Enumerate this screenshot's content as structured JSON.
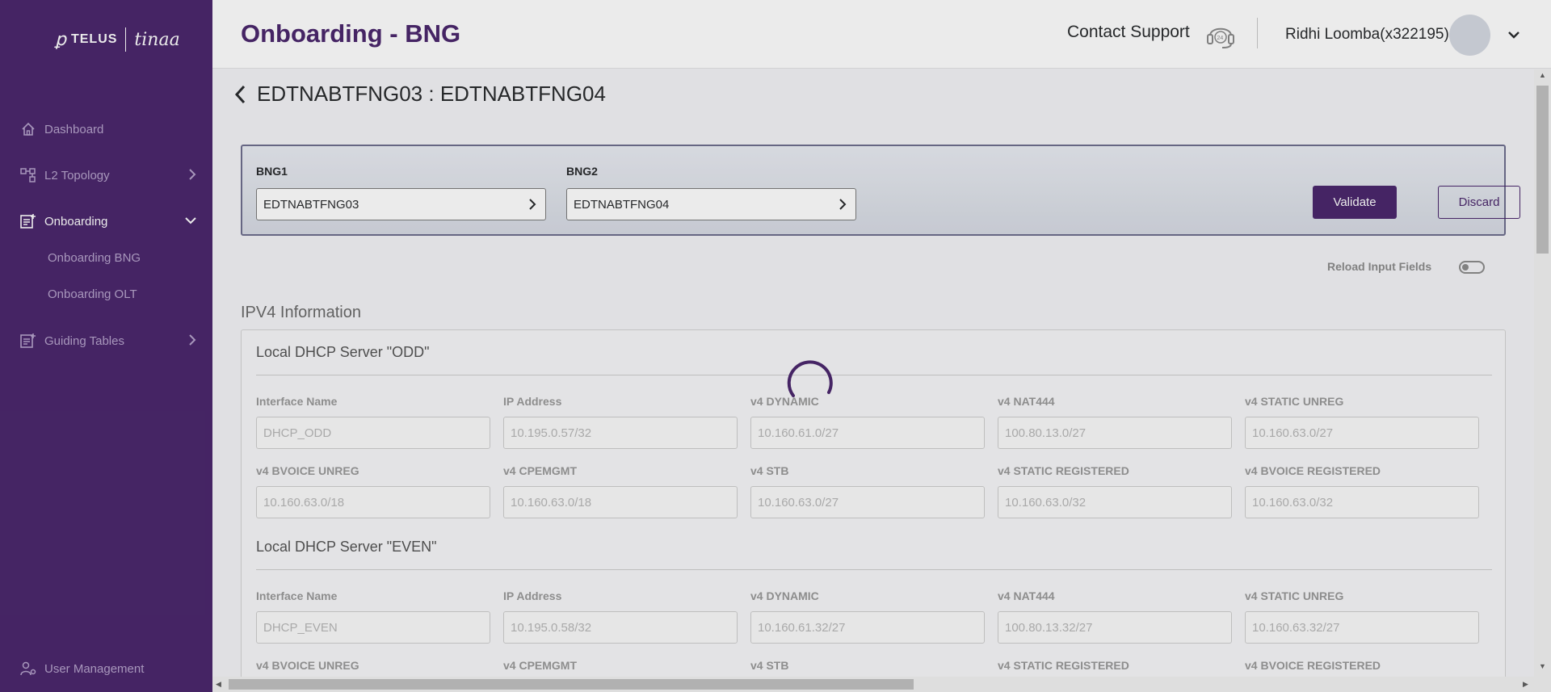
{
  "brand": {
    "mark": "ꝑ",
    "name": "TELUS",
    "product": "tinaa"
  },
  "sidebar": {
    "items": [
      {
        "label": "Dashboard",
        "icon": "home-icon"
      },
      {
        "label": "L2 Topology",
        "icon": "topology-icon"
      },
      {
        "label": "Onboarding",
        "icon": "onboarding-icon",
        "expanded": true
      },
      {
        "label": "Guiding Tables",
        "icon": "table-icon"
      }
    ],
    "sub_items": [
      {
        "label": "Onboarding BNG"
      },
      {
        "label": "Onboarding OLT"
      }
    ],
    "footer": {
      "label": "User Management",
      "icon": "user-gear-icon"
    }
  },
  "header": {
    "title": "Onboarding - BNG",
    "support_label": "Contact Support",
    "support_icon": "headset-24-icon",
    "user_name": "Ridhi Loomba(x322195)"
  },
  "page": {
    "breadcrumb_title": "EDTNABTFNG03 : EDTNABTFNG04",
    "bng1_label": "BNG1",
    "bng1_value": "EDTNABTFNG03",
    "bng2_label": "BNG2",
    "bng2_value": "EDTNABTFNG04",
    "validate_label": "Validate",
    "discard_label": "Discard",
    "reload_label": "Reload Input Fields",
    "reload_enabled": false,
    "section_title": "IPV4 Information",
    "loading": true
  },
  "servers": [
    {
      "title": "Local DHCP Server \"ODD\"",
      "fields": [
        {
          "label": "Interface Name",
          "value": "DHCP_ODD"
        },
        {
          "label": "IP Address",
          "value": "10.195.0.57/32"
        },
        {
          "label": "v4 DYNAMIC",
          "value": "10.160.61.0/27"
        },
        {
          "label": "v4 NAT444",
          "value": "100.80.13.0/27"
        },
        {
          "label": "v4 STATIC UNREG",
          "value": "10.160.63.0/27"
        },
        {
          "label": "v4 BVOICE UNREG",
          "value": "10.160.63.0/18"
        },
        {
          "label": "v4 CPEMGMT",
          "value": "10.160.63.0/18"
        },
        {
          "label": "v4 STB",
          "value": "10.160.63.0/27"
        },
        {
          "label": "v4 STATIC REGISTERED",
          "value": "10.160.63.0/32"
        },
        {
          "label": "v4 BVOICE REGISTERED",
          "value": "10.160.63.0/32"
        }
      ]
    },
    {
      "title": "Local DHCP Server \"EVEN\"",
      "fields": [
        {
          "label": "Interface Name",
          "value": "DHCP_EVEN"
        },
        {
          "label": "IP Address",
          "value": "10.195.0.58/32"
        },
        {
          "label": "v4 DYNAMIC",
          "value": "10.160.61.32/27"
        },
        {
          "label": "v4 NAT444",
          "value": "100.80.13.32/27"
        },
        {
          "label": "v4 STATIC UNREG",
          "value": "10.160.63.32/27"
        },
        {
          "label": "v4 BVOICE UNREG",
          "value": ""
        },
        {
          "label": "v4 CPEMGMT",
          "value": ""
        },
        {
          "label": "v4 STB",
          "value": ""
        },
        {
          "label": "v4 STATIC REGISTERED",
          "value": ""
        },
        {
          "label": "v4 BVOICE REGISTERED",
          "value": ""
        }
      ]
    }
  ],
  "colors": {
    "brand_purple": "#4b286d",
    "sidebar_text": "#b7a4cc",
    "accent_spinner": "#4b286d"
  }
}
